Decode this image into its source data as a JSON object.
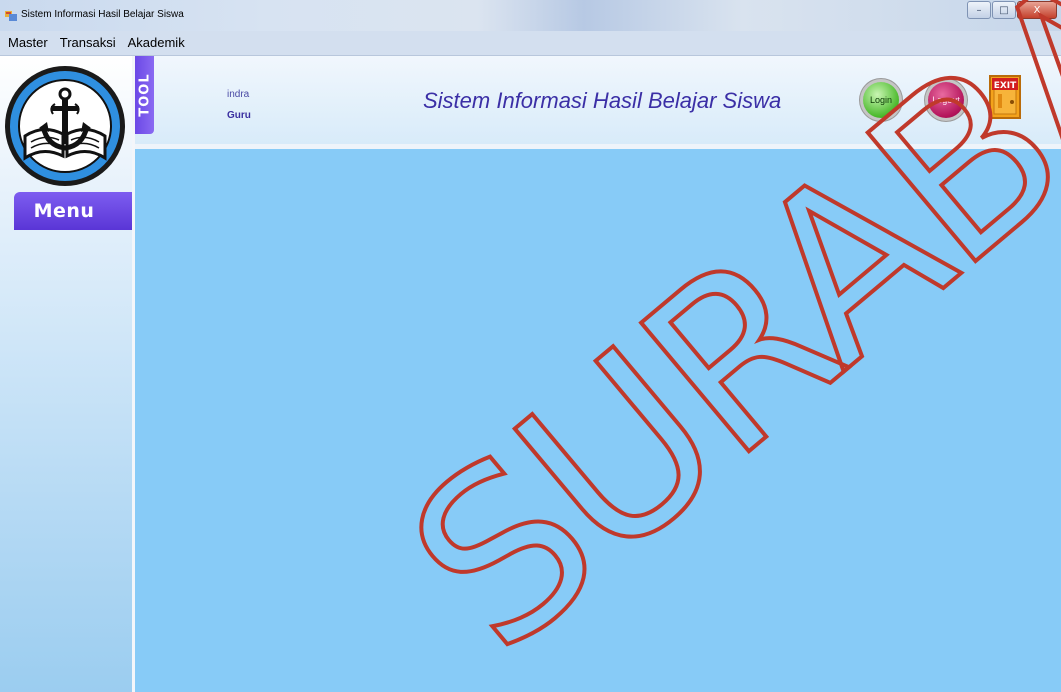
{
  "window": {
    "title": "Sistem Informasi Hasil Belajar Siswa",
    "icon": "app-window-icon",
    "minimize_label": "–",
    "maximize_label": "□",
    "close_label": "X"
  },
  "menubar": {
    "items": [
      {
        "label": "Master"
      },
      {
        "label": "Transaksi"
      },
      {
        "label": "Akademik"
      }
    ]
  },
  "sidebar": {
    "logo": "school-emblem-logo",
    "menu_header": "Menu"
  },
  "header": {
    "tool_label": "TOOL",
    "user_name": "indra",
    "user_role": "Guru",
    "app_title": "Sistem Informasi Hasil Belajar Siswa",
    "login_label": "Login",
    "logout_label": "Logout",
    "exit_label": "EXIT"
  },
  "watermark": {
    "text": "SURABAYA",
    "color": "#c0392b"
  },
  "colors": {
    "content_background": "#87cbf7",
    "accent_purple": "#6b48e6",
    "title_blue": "#3b2fa6"
  }
}
